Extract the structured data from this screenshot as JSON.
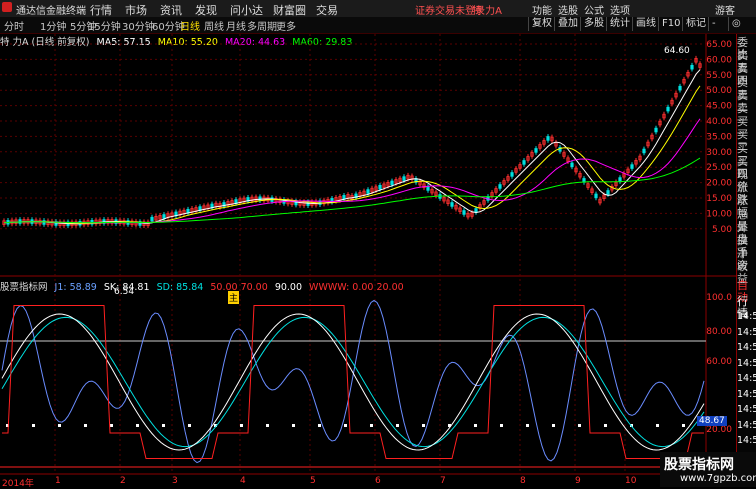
{
  "topbar": {
    "app_title": "通达信金融终端",
    "menu": [
      "行情",
      "市场",
      "资讯",
      "发现",
      "问小达",
      "财富圈",
      "交易"
    ],
    "warning": "证券交易未登录",
    "stock_name": "特 力A",
    "right_menu": [
      "功能",
      "选股",
      "公式",
      "选项",
      "游客"
    ]
  },
  "periodbar": {
    "periods": [
      "分时",
      "1分钟",
      "5分钟",
      "15分钟",
      "30分钟",
      "60分钟",
      "日线",
      "周线",
      "月线",
      "多周期",
      "更多"
    ],
    "active_period": "日线",
    "tools": [
      "复权",
      "叠加",
      "多股",
      "统计",
      "画线",
      "F10",
      "标记",
      "-",
      "◎"
    ]
  },
  "ma_legend": {
    "title": "特 力A (日线 前复权)",
    "ma5": "MA5: 57.15",
    "ma10": "MA10: 55.20",
    "ma20": "MA20: 44.63",
    "ma60": "MA60: 29.83"
  },
  "price_marks": {
    "high": "64.60",
    "low": "6.54",
    "marker": "主"
  },
  "side_panel": {
    "labels": [
      "委比",
      "卖五",
      "卖四",
      "卖三",
      "卖二",
      "卖一",
      "买一",
      "买二",
      "买三",
      "买四",
      "现价",
      "涨跌",
      "涨幅",
      "总量",
      "外盘",
      "换手",
      "净资",
      "收益"
    ],
    "lower_labels": [
      "自动",
      "行情",
      "14:50",
      "14:50",
      "14:50",
      "14:50",
      "14:50",
      "14:50",
      "14:50",
      "14:50",
      "14:50"
    ]
  },
  "indicator_legend": {
    "name": "股票指标网",
    "j1": "J1: 58.89",
    "sk": "SK: 84.81",
    "sd": "SD: 85.84",
    "lines": "50.00  70.00",
    "v90": "90.00",
    "wwww": "WWWW: 0.00  20.00"
  },
  "price_axis": [
    "65.00",
    "60.00",
    "55.00",
    "50.00",
    "45.00",
    "40.00",
    "35.00",
    "30.00",
    "25.00",
    "20.00",
    "15.00",
    "10.00",
    "5.00"
  ],
  "indicator_axis": [
    "100.0",
    "80.00",
    "60.00",
    "48.67",
    "20.00",
    "0.00"
  ],
  "current_indicator": "48.67",
  "x_ticks": [
    "2014年",
    "1",
    "2",
    "3",
    "4",
    "5",
    "6",
    "7",
    "8",
    "9",
    "10"
  ],
  "watermark": {
    "line1": "股票指标网",
    "line2": "www.7gpzb.com"
  },
  "colors": {
    "up": "#ff3030",
    "down": "#00e0e0",
    "ma5": "#ffffff",
    "ma10": "#ffff00",
    "ma20": "#ff00ff",
    "ma60": "#00ff00",
    "grid": "#8b0000"
  }
}
